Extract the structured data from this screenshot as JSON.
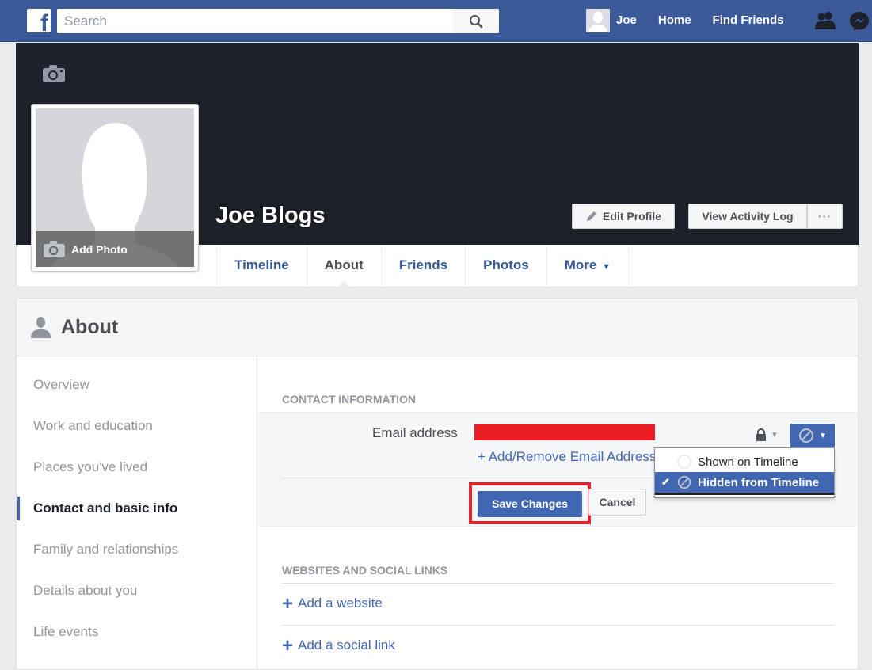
{
  "topbar": {
    "logo": "f",
    "search_placeholder": "Search",
    "user_name": "Joe",
    "links": [
      "Home",
      "Find Friends"
    ],
    "icons": [
      "friend-requests-icon",
      "messenger-icon"
    ]
  },
  "profile": {
    "name": "Joe Blogs",
    "add_photo_label": "Add Photo",
    "edit_profile_label": "Edit Profile",
    "activity_log_label": "View Activity Log",
    "more_options_label": "···"
  },
  "tabs": [
    {
      "label": "Timeline",
      "active": false
    },
    {
      "label": "About",
      "active": true
    },
    {
      "label": "Friends",
      "active": false
    },
    {
      "label": "Photos",
      "active": false
    },
    {
      "label": "More",
      "active": false
    }
  ],
  "about": {
    "title": "About",
    "sidebar": [
      {
        "label": "Overview",
        "active": false
      },
      {
        "label": "Work and education",
        "active": false
      },
      {
        "label": "Places you've lived",
        "active": false
      },
      {
        "label": "Contact and basic info",
        "active": true
      },
      {
        "label": "Family and relationships",
        "active": false
      },
      {
        "label": "Details about you",
        "active": false
      },
      {
        "label": "Life events",
        "active": false
      }
    ],
    "contact": {
      "heading": "CONTACT INFORMATION",
      "email_label": "Email address",
      "email_value": "[redacted]",
      "add_remove_link": "+ Add/Remove Email Address",
      "save_label": "Save Changes",
      "cancel_label": "Cancel",
      "visibility_menu": {
        "options": [
          "Shown on Timeline",
          "Hidden from Timeline"
        ],
        "selected": "Hidden from Timeline"
      }
    },
    "websites": {
      "heading": "WEBSITES AND SOCIAL LINKS",
      "add_website": "Add a website",
      "add_social": "Add a social link"
    }
  },
  "colors": {
    "brand": "#3b5998",
    "accent": "#4267b2",
    "highlight_box": "#e0232e",
    "redaction": "#ec1c24"
  }
}
